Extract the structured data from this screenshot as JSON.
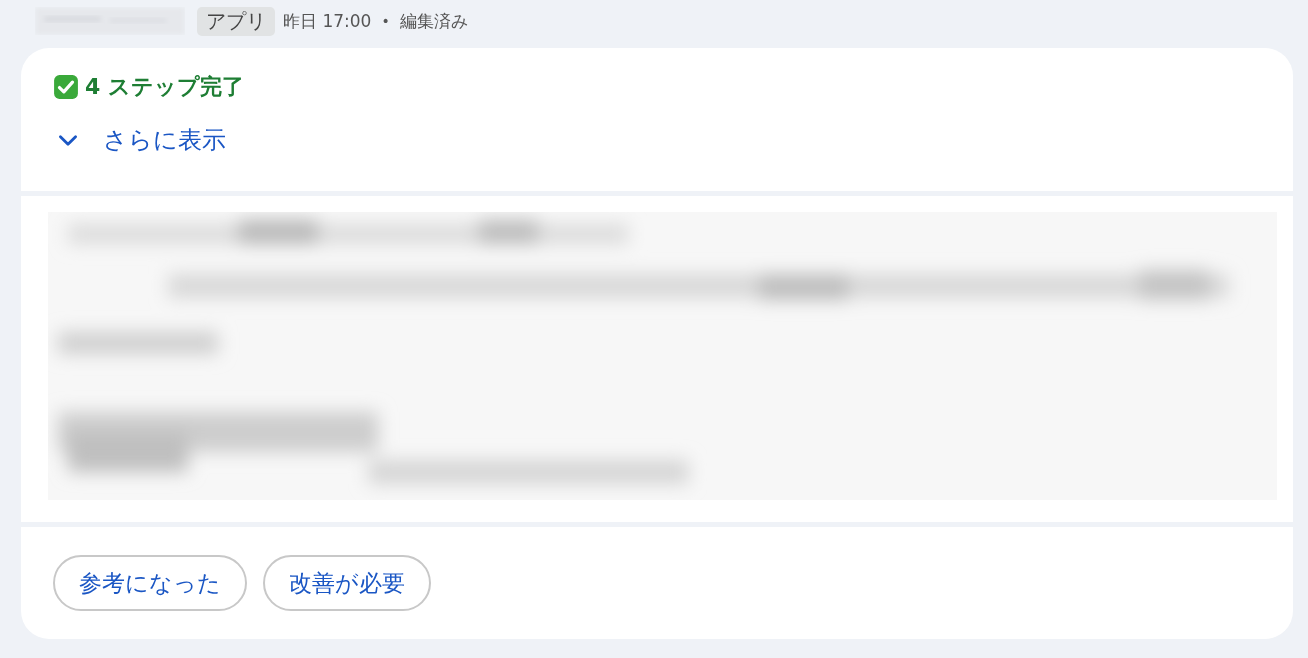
{
  "header": {
    "tag": "アプリ",
    "time": "昨日 17:00",
    "separator": "•",
    "status": "編集済み"
  },
  "summary": {
    "title": "4 ステップ完了",
    "expanded": false,
    "toggle_label": "さらに表示"
  },
  "feedback_buttons": [
    "参考になった",
    "改善が必要"
  ]
}
